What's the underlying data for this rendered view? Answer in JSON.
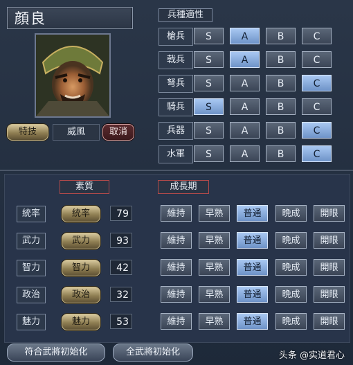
{
  "general": {
    "name": "顔良"
  },
  "skill": {
    "button_label": "特技",
    "current_value": "威風",
    "cancel_label": "取消"
  },
  "aptitude": {
    "header": "兵種適性",
    "grade_labels": [
      "S",
      "A",
      "B",
      "C"
    ],
    "units": [
      {
        "label": "槍兵",
        "selected": "A"
      },
      {
        "label": "戟兵",
        "selected": "A"
      },
      {
        "label": "弩兵",
        "selected": "C"
      },
      {
        "label": "騎兵",
        "selected": "S"
      },
      {
        "label": "兵器",
        "selected": "C"
      },
      {
        "label": "水軍",
        "selected": "C"
      }
    ]
  },
  "stats": {
    "quality_header": "素質",
    "growth_header": "成長期",
    "growth_options": [
      "維持",
      "早熟",
      "普通",
      "晩成",
      "開眼"
    ],
    "rows": [
      {
        "label": "統率",
        "button": "統率",
        "value": "79",
        "growth": "普通"
      },
      {
        "label": "武力",
        "button": "武力",
        "value": "93",
        "growth": "普通"
      },
      {
        "label": "智力",
        "button": "智力",
        "value": "42",
        "growth": "普通"
      },
      {
        "label": "政治",
        "button": "政治",
        "value": "32",
        "growth": "普通"
      },
      {
        "label": "魅力",
        "button": "魅力",
        "value": "53",
        "growth": "普通"
      }
    ]
  },
  "footer": {
    "init_matching": "符合武將初始化",
    "init_all": "全武將初始化"
  },
  "watermark": {
    "text": "头条 @实道君心"
  },
  "colors": {
    "selected": "#8fb2e4",
    "gold_button": "#b5a270",
    "cancel_button": "#4a2226"
  }
}
